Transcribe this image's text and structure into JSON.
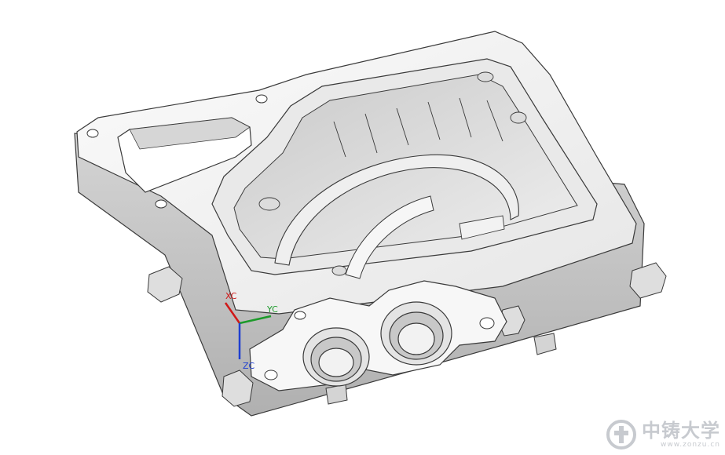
{
  "viewport": {
    "background": "#ffffff",
    "model_colors": {
      "body_light": "#f2f2f2",
      "body_mid": "#d9d9d9",
      "body_dark": "#a8a8a8",
      "edge": "#3a3a3a"
    }
  },
  "triad": {
    "x_label": "XC",
    "y_label": "YC",
    "z_label": "ZC",
    "x_color": "#d01818",
    "y_color": "#1c9a2a",
    "z_color": "#1f3fd0"
  },
  "watermark": {
    "icon": "zhongzhu-logo-icon",
    "title": "中铸大学",
    "url": "www.zonzu.cn"
  }
}
